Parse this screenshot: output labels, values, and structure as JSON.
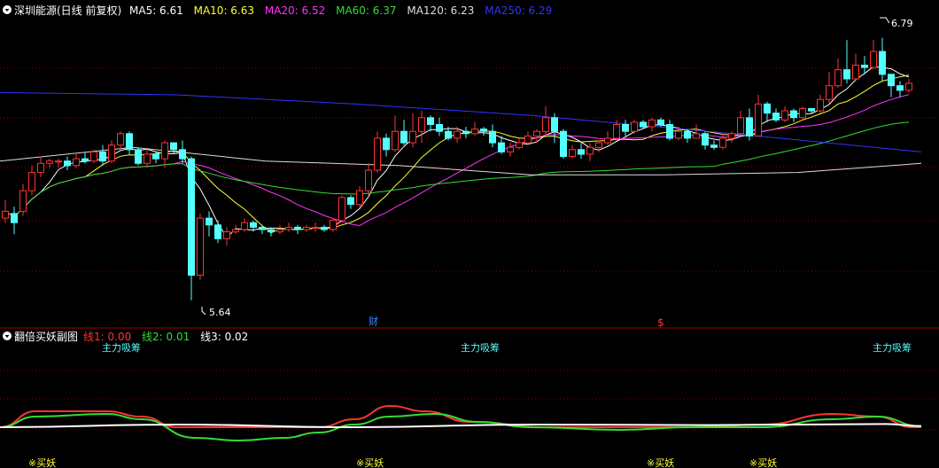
{
  "header": {
    "title": "深圳能源(日线 前复权)",
    "ma_items": [
      {
        "label": "MA5: 6.61",
        "color": "#ffffff"
      },
      {
        "label": "MA10: 6.63",
        "color": "#ffff33"
      },
      {
        "label": "MA20: 6.52",
        "color": "#ff33ff"
      },
      {
        "label": "MA60: 6.37",
        "color": "#33dd33"
      },
      {
        "label": "MA120: 6.23",
        "color": "#dddddd"
      },
      {
        "label": "MA250: 6.29",
        "color": "#3333ff"
      }
    ]
  },
  "sub_header": {
    "title": "翻倍买妖副图",
    "line_items": [
      {
        "label": "线1: 0.00",
        "color": "#ff3333"
      },
      {
        "label": "线2: 0.01",
        "color": "#33dd33"
      },
      {
        "label": "线3: 0.02",
        "color": "#ffffff"
      }
    ]
  },
  "annotations": {
    "high_label": "6.79",
    "low_label": "5.64",
    "fin_marker": "财",
    "dollar_marker": "$",
    "zhuli_labels": [
      "主力吸筹",
      "主力吸筹",
      "主力吸筹"
    ],
    "buy_labels": [
      "※买妖",
      "※买妖",
      "※买妖",
      "※买妖"
    ]
  },
  "colors": {
    "up": "#ff3333",
    "down": "#54ffff",
    "grid": "#880000",
    "separator": "#aa0000"
  },
  "chart_data": {
    "type": "candlestick",
    "y_range": [
      5.55,
      6.87
    ],
    "candles": [
      [
        6.0,
        6.03,
        6.08,
        5.98
      ],
      [
        6.02,
        5.98,
        6.05,
        5.93
      ],
      [
        6.03,
        6.12,
        6.15,
        6.01
      ],
      [
        6.12,
        6.2,
        6.23,
        6.1
      ],
      [
        6.2,
        6.24,
        6.27,
        6.18
      ],
      [
        6.24,
        6.25,
        6.26,
        6.22
      ],
      [
        6.25,
        6.25,
        6.26,
        6.22
      ],
      [
        6.25,
        6.23,
        6.27,
        6.21
      ],
      [
        6.23,
        6.26,
        6.28,
        6.22
      ],
      [
        6.26,
        6.25,
        6.29,
        6.24
      ],
      [
        6.25,
        6.29,
        6.3,
        6.24
      ],
      [
        6.29,
        6.25,
        6.32,
        6.23
      ],
      [
        6.25,
        6.32,
        6.34,
        6.24
      ],
      [
        6.32,
        6.37,
        6.38,
        6.3
      ],
      [
        6.37,
        6.3,
        6.38,
        6.28
      ],
      [
        6.3,
        6.24,
        6.31,
        6.23
      ],
      [
        6.24,
        6.28,
        6.3,
        6.22
      ],
      [
        6.28,
        6.26,
        6.29,
        6.24
      ],
      [
        6.26,
        6.33,
        6.34,
        6.22
      ],
      [
        6.33,
        6.3,
        6.32,
        6.28
      ],
      [
        6.3,
        6.26,
        6.34,
        6.24
      ],
      [
        6.26,
        5.75,
        6.27,
        5.64
      ],
      [
        5.75,
        6.0,
        6.02,
        5.73
      ],
      [
        6.0,
        5.97,
        6.03,
        5.92
      ],
      [
        5.97,
        5.91,
        5.99,
        5.89
      ],
      [
        5.91,
        5.94,
        5.96,
        5.88
      ],
      [
        5.94,
        5.95,
        5.97,
        5.93
      ],
      [
        5.95,
        5.98,
        6.0,
        5.94
      ],
      [
        5.98,
        5.96,
        5.99,
        5.94
      ],
      [
        5.96,
        5.95,
        5.97,
        5.93
      ],
      [
        5.95,
        5.94,
        5.96,
        5.92
      ],
      [
        5.94,
        5.95,
        5.97,
        5.93
      ],
      [
        5.95,
        5.96,
        5.98,
        5.94
      ],
      [
        5.96,
        5.95,
        5.97,
        5.93
      ],
      [
        5.95,
        5.96,
        5.97,
        5.94
      ],
      [
        5.96,
        5.96,
        5.98,
        5.94
      ],
      [
        5.96,
        5.95,
        5.97,
        5.94
      ],
      [
        5.95,
        5.99,
        6.0,
        5.94
      ],
      [
        5.99,
        6.09,
        6.1,
        5.98
      ],
      [
        6.09,
        6.06,
        6.1,
        6.04
      ],
      [
        6.06,
        6.12,
        6.14,
        6.05
      ],
      [
        6.12,
        6.21,
        6.24,
        6.1
      ],
      [
        6.21,
        6.35,
        6.38,
        6.2
      ],
      [
        6.35,
        6.3,
        6.37,
        6.27
      ],
      [
        6.3,
        6.38,
        6.45,
        6.29
      ],
      [
        6.38,
        6.33,
        6.43,
        6.32
      ],
      [
        6.33,
        6.38,
        6.46,
        6.31
      ],
      [
        6.38,
        6.44,
        6.47,
        6.33
      ],
      [
        6.44,
        6.41,
        6.45,
        6.38
      ],
      [
        6.41,
        6.38,
        6.44,
        6.36
      ],
      [
        6.38,
        6.35,
        6.4,
        6.34
      ],
      [
        6.35,
        6.38,
        6.4,
        6.33
      ],
      [
        6.38,
        6.37,
        6.4,
        6.35
      ],
      [
        6.37,
        6.39,
        6.42,
        6.36
      ],
      [
        6.39,
        6.38,
        6.4,
        6.36
      ],
      [
        6.38,
        6.33,
        6.41,
        6.31
      ],
      [
        6.33,
        6.29,
        6.36,
        6.28
      ],
      [
        6.29,
        6.31,
        6.33,
        6.27
      ],
      [
        6.31,
        6.33,
        6.35,
        6.3
      ],
      [
        6.33,
        6.36,
        6.38,
        6.32
      ],
      [
        6.36,
        6.38,
        6.39,
        6.33
      ],
      [
        6.38,
        6.44,
        6.49,
        6.36
      ],
      [
        6.44,
        6.38,
        6.46,
        6.33
      ],
      [
        6.38,
        6.27,
        6.39,
        6.26
      ],
      [
        6.27,
        6.3,
        6.32,
        6.26
      ],
      [
        6.3,
        6.28,
        6.33,
        6.26
      ],
      [
        6.28,
        6.31,
        6.33,
        6.25
      ],
      [
        6.31,
        6.33,
        6.34,
        6.29
      ],
      [
        6.33,
        6.35,
        6.38,
        6.32
      ],
      [
        6.35,
        6.41,
        6.43,
        6.34
      ],
      [
        6.41,
        6.38,
        6.43,
        6.36
      ],
      [
        6.38,
        6.42,
        6.43,
        6.37
      ],
      [
        6.42,
        6.4,
        6.43,
        6.39
      ],
      [
        6.4,
        6.43,
        6.44,
        6.38
      ],
      [
        6.43,
        6.41,
        6.44,
        6.4
      ],
      [
        6.41,
        6.35,
        6.43,
        6.34
      ],
      [
        6.35,
        6.38,
        6.4,
        6.34
      ],
      [
        6.38,
        6.35,
        6.39,
        6.33
      ],
      [
        6.35,
        6.37,
        6.41,
        6.35
      ],
      [
        6.37,
        6.32,
        6.38,
        6.3
      ],
      [
        6.32,
        6.31,
        6.34,
        6.3
      ],
      [
        6.31,
        6.35,
        6.37,
        6.3
      ],
      [
        6.35,
        6.37,
        6.38,
        6.33
      ],
      [
        6.37,
        6.44,
        6.47,
        6.36
      ],
      [
        6.44,
        6.36,
        6.48,
        6.34
      ],
      [
        6.36,
        6.5,
        6.54,
        6.38
      ],
      [
        6.5,
        6.46,
        6.51,
        6.42
      ],
      [
        6.46,
        6.43,
        6.48,
        6.42
      ],
      [
        6.43,
        6.47,
        6.49,
        6.42
      ],
      [
        6.47,
        6.44,
        6.48,
        6.42
      ],
      [
        6.44,
        6.48,
        6.49,
        6.43
      ],
      [
        6.48,
        6.47,
        6.48,
        6.46
      ],
      [
        6.47,
        6.52,
        6.54,
        6.46
      ],
      [
        6.52,
        6.58,
        6.64,
        6.5
      ],
      [
        6.58,
        6.65,
        6.7,
        6.57
      ],
      [
        6.65,
        6.61,
        6.78,
        6.59
      ],
      [
        6.61,
        6.67,
        6.72,
        6.6
      ],
      [
        6.67,
        6.66,
        6.71,
        6.63
      ],
      [
        6.66,
        6.73,
        6.78,
        6.65
      ],
      [
        6.73,
        6.63,
        6.79,
        6.6
      ],
      [
        6.63,
        6.58,
        6.62,
        6.53
      ],
      [
        6.58,
        6.56,
        6.6,
        6.53
      ],
      [
        6.56,
        6.59,
        6.61,
        6.55
      ]
    ],
    "sub_series": {
      "line1": [
        [
          0,
          0.0
        ],
        [
          40,
          0.3
        ],
        [
          120,
          0.3
        ],
        [
          160,
          0.2
        ],
        [
          200,
          0.0
        ],
        [
          280,
          0.0
        ],
        [
          360,
          0.0
        ],
        [
          400,
          0.15
        ],
        [
          440,
          0.4
        ],
        [
          480,
          0.3
        ],
        [
          530,
          0.1
        ],
        [
          620,
          0.0
        ],
        [
          700,
          0.0
        ],
        [
          780,
          0.0
        ],
        [
          860,
          0.05
        ],
        [
          940,
          0.25
        ],
        [
          990,
          0.2
        ],
        [
          1030,
          0.0
        ],
        [
          1040,
          0.0
        ]
      ],
      "line2": [
        [
          0,
          0.0
        ],
        [
          40,
          0.2
        ],
        [
          120,
          0.25
        ],
        [
          160,
          0.15
        ],
        [
          220,
          -0.2
        ],
        [
          270,
          -0.25
        ],
        [
          320,
          -0.2
        ],
        [
          360,
          -0.1
        ],
        [
          400,
          0.05
        ],
        [
          440,
          0.2
        ],
        [
          490,
          0.25
        ],
        [
          540,
          0.1
        ],
        [
          600,
          0.0
        ],
        [
          700,
          -0.05
        ],
        [
          780,
          0.0
        ],
        [
          860,
          0.0
        ],
        [
          940,
          0.15
        ],
        [
          990,
          0.2
        ],
        [
          1040,
          0.02
        ]
      ],
      "line3": [
        [
          0,
          0.0
        ],
        [
          200,
          0.05
        ],
        [
          400,
          0.0
        ],
        [
          600,
          0.05
        ],
        [
          800,
          0.04
        ],
        [
          1000,
          0.06
        ],
        [
          1040,
          0.02
        ]
      ]
    }
  }
}
